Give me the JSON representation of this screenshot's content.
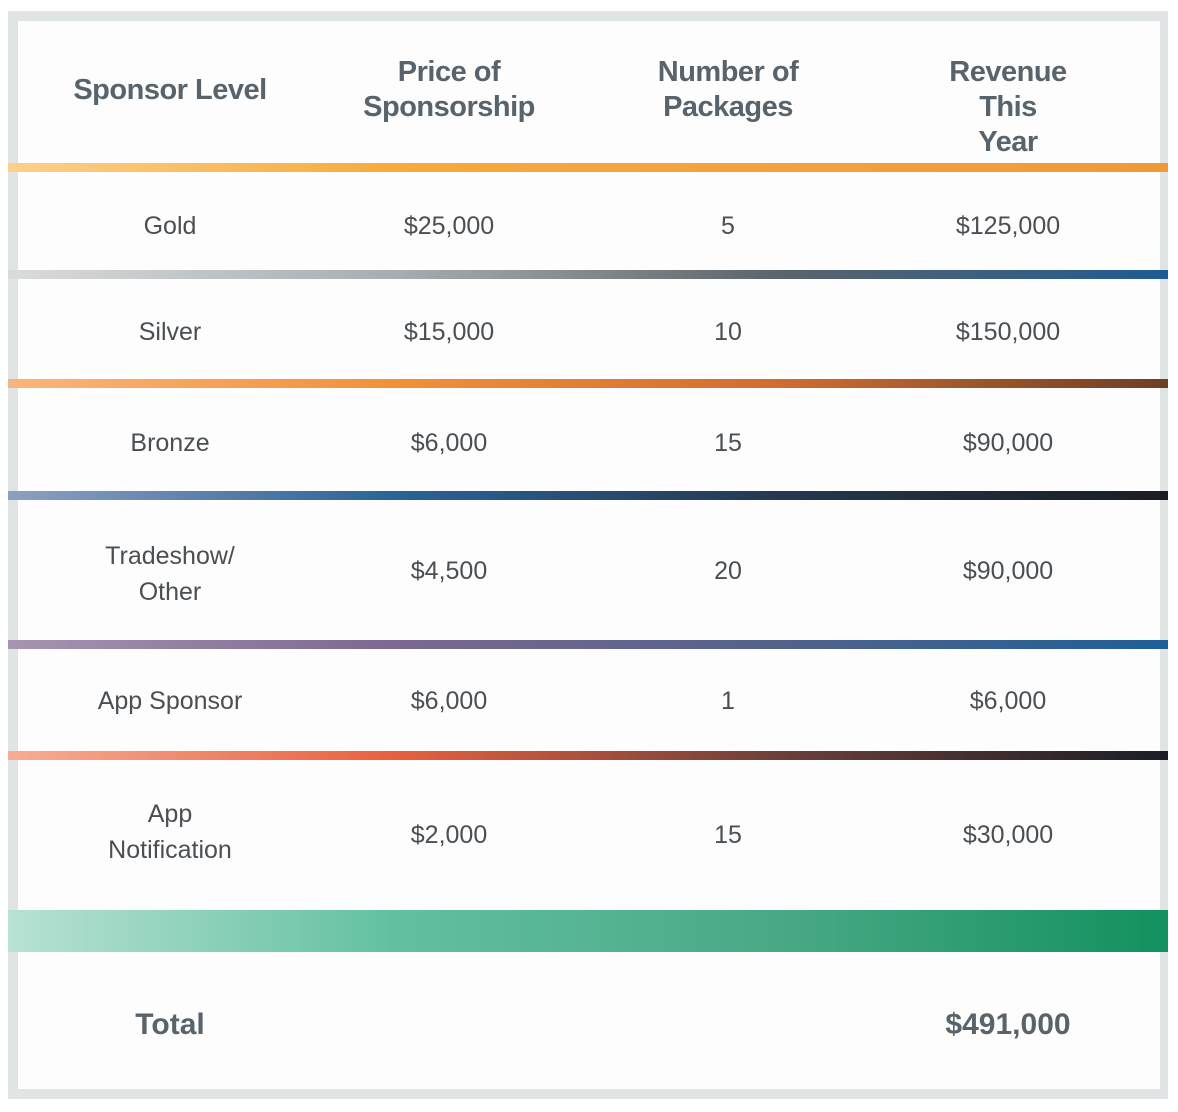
{
  "table": {
    "headers": [
      [
        "Sponsor Level"
      ],
      [
        "Price of",
        "Sponsorship"
      ],
      [
        "Number of",
        "Packages"
      ],
      [
        "Revenue This",
        "Year"
      ]
    ],
    "rows": [
      {
        "level": [
          "Gold"
        ],
        "price": "$25,000",
        "packages": "5",
        "revenue": "$125,000"
      },
      {
        "level": [
          "Silver"
        ],
        "price": "$15,000",
        "packages": "10",
        "revenue": "$150,000"
      },
      {
        "level": [
          "Bronze"
        ],
        "price": "$6,000",
        "packages": "15",
        "revenue": "$90,000"
      },
      {
        "level": [
          "Tradeshow/",
          "Other"
        ],
        "price": "$4,500",
        "packages": "20",
        "revenue": "$90,000"
      },
      {
        "level": [
          "App Sponsor"
        ],
        "price": "$6,000",
        "packages": "1",
        "revenue": "$6,000"
      },
      {
        "level": [
          "App",
          "Notification"
        ],
        "price": "$2,000",
        "packages": "15",
        "revenue": "$30,000"
      }
    ],
    "total": {
      "label": "Total",
      "revenue": "$491,000"
    }
  },
  "colors": {
    "frame": "#e1e4e5",
    "header_text": "#58636b",
    "body_text": "#4a4f53",
    "separators": [
      [
        "#fcd08a",
        "#f6ab3a",
        "#f3a13c",
        "#ef9a38"
      ],
      [
        "#d9dbdc",
        "#a9adb0",
        "#5b646b",
        "#1f5b92"
      ],
      [
        "#fbb57a",
        "#f0913b",
        "#cf6d30",
        "#6c3f26"
      ],
      [
        "#8e9fc0",
        "#2a6397",
        "#25384f",
        "#1b1d22"
      ],
      [
        "#a595b2",
        "#7c6890",
        "#52628b",
        "#1f5f97"
      ],
      [
        "#f7ad94",
        "#e8603e",
        "#6c3f39",
        "#1a1e26"
      ],
      [
        "#b8e2d3",
        "#62c0a1",
        "#49a985",
        "#13915f"
      ]
    ]
  }
}
